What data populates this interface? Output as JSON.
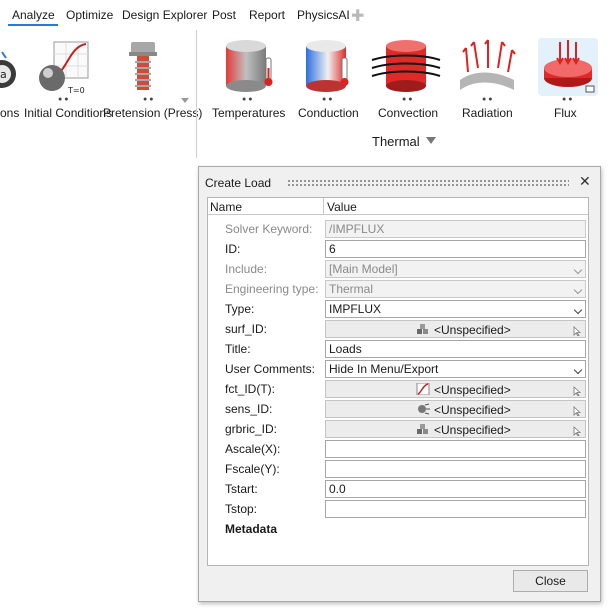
{
  "menu": {
    "tabs": [
      "Analyze",
      "Optimize",
      "Design Explorer",
      "Post",
      "Report",
      "PhysicsAI"
    ],
    "active": "Analyze"
  },
  "ribbon": {
    "tools_left": [
      {
        "label": "ons",
        "icon": "constraint-sphere-icon"
      },
      {
        "label": "Initial Conditions",
        "icon": "initial-conditions-icon"
      },
      {
        "label": "Pretension (Press)",
        "icon": "bolt-pretension-icon"
      }
    ],
    "thermal_tools": [
      {
        "label": "Temperatures",
        "icon": "temperature-cylinder-icon"
      },
      {
        "label": "Conduction",
        "icon": "conduction-cylinder-icon"
      },
      {
        "label": "Convection",
        "icon": "convection-icon"
      },
      {
        "label": "Radiation",
        "icon": "radiation-icon"
      },
      {
        "label": "Flux",
        "icon": "flux-icon"
      }
    ],
    "initial_conditions_sublabel": "T=0",
    "group_label": "Thermal"
  },
  "dialog": {
    "title": "Create Load",
    "header": {
      "name": "Name",
      "value": "Value"
    },
    "rows": [
      {
        "label": "Solver Keyword:",
        "value": "/IMPFLUX",
        "kind": "text",
        "disabled": true
      },
      {
        "label": "ID:",
        "value": "6",
        "kind": "text",
        "disabled": false
      },
      {
        "label": "Include:",
        "value": "[Main Model]",
        "kind": "select",
        "disabled": true
      },
      {
        "label": "Engineering type:",
        "value": "Thermal",
        "kind": "select",
        "disabled": true
      },
      {
        "label": "Type:",
        "value": "IMPFLUX",
        "kind": "select",
        "disabled": false
      },
      {
        "label": "surf_ID:",
        "value": "<Unspecified>",
        "kind": "entity",
        "icon": "component-blocks-icon"
      },
      {
        "label": "Title:",
        "value": "Loads",
        "kind": "text",
        "disabled": false
      },
      {
        "label": "User Comments:",
        "value": "Hide In Menu/Export",
        "kind": "select",
        "disabled": false
      },
      {
        "label": "fct_ID(T):",
        "value": "<Unspecified>",
        "kind": "entity",
        "icon": "curve-plot-icon"
      },
      {
        "label": "sens_ID:",
        "value": "<Unspecified>",
        "kind": "entity",
        "icon": "sensor-icon"
      },
      {
        "label": "grbric_ID:",
        "value": "<Unspecified>",
        "kind": "entity",
        "icon": "component-blocks-icon"
      },
      {
        "label": "Ascale(X):",
        "value": "",
        "kind": "text",
        "disabled": false
      },
      {
        "label": "Fscale(Y):",
        "value": "",
        "kind": "text",
        "disabled": false
      },
      {
        "label": "Tstart:",
        "value": "0.0",
        "kind": "text",
        "disabled": false
      },
      {
        "label": "Tstop:",
        "value": "",
        "kind": "text",
        "disabled": false
      },
      {
        "label": "Metadata",
        "value": "",
        "kind": "section"
      }
    ],
    "close_label": "Close"
  },
  "colors": {
    "accent": "#2a7ad5",
    "dialog_bg": "#f0f0f0"
  }
}
